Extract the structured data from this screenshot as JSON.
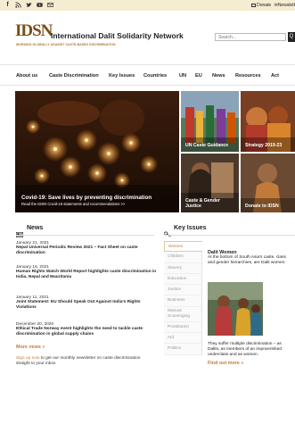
{
  "topbar": {
    "social": [
      "f",
      "rss",
      "twitter",
      "youtube",
      "mail"
    ],
    "donate_label": "Donate",
    "newsletter_label": "Newslett"
  },
  "header": {
    "logo_mark": "IDSN",
    "org_name": "International Dalit Solidarity Network",
    "tagline": "WORKING GLOBALLY AGAINST CASTE-BASED DISCRIMINATION",
    "search_placeholder": "Search...",
    "search_button": "Q"
  },
  "nav": [
    "About us",
    "Caste Discrimination",
    "Key Issues",
    "Countries",
    "UN",
    "EU",
    "News",
    "Resources",
    "Act"
  ],
  "hero": {
    "title": "Covid-19: Save lives by preventing discrimination",
    "subtitle": "Read the IDSN Covid-19 statements and recommendations >>"
  },
  "tiles": [
    "UN Caste Guidance",
    "Strategy 2019-23",
    "Caste & Gender Justice",
    "Donate to IDSN"
  ],
  "news": {
    "title": "News",
    "items": [
      {
        "date": "January 21, 2021",
        "title": "Nepal Universal Periodic Review 2021 – Fact Sheet on caste discrimination"
      },
      {
        "date": "January 16, 2021",
        "title": "Human Rights Watch World Report highlights caste discrimination in India, Nepal and Mauritania"
      },
      {
        "date": "January 11, 2021",
        "title": "Joint Statement: EU Should Speak Out Against India's Rights Violations"
      },
      {
        "date": "December 20, 2020",
        "title": "Ethical Trade Norway event highlights the need to tackle caste discrimination in global supply chains"
      }
    ],
    "more_label": "More news »",
    "signup_link": "Sign up now",
    "signup_text": " to get our monthly newsletter on caste discrimination straight to your inbox"
  },
  "key_issues": {
    "title": "Key Issues",
    "tabs": [
      "Women",
      "Children",
      "Slavery",
      "Education",
      "Justice",
      "Business",
      "Manual Scavenging",
      "Prostitution",
      "Aid",
      "Politics"
    ],
    "active_tab": "Women",
    "panel_title": "Dalit Women",
    "panel_text": "At the bottom of South Asia's caste, class and gender hierarchies, are Dalit women.",
    "panel_text2": "They suffer multiple discrimination – as Dalits, as members of an impoverished underclass and as women.",
    "find_more": "Find out more »"
  }
}
